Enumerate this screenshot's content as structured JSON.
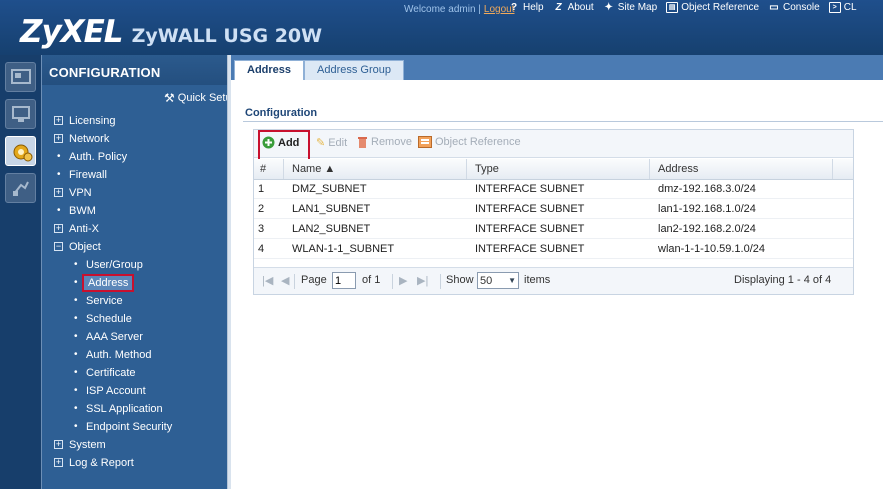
{
  "header": {
    "logo": "ZyXEL",
    "model": "ZyWALL USG 20W",
    "welcome": "Welcome admin |",
    "logout": "Logout",
    "links": [
      {
        "label": "Help",
        "icon": "help-icon"
      },
      {
        "label": "About",
        "icon": "about-icon"
      },
      {
        "label": "Site Map",
        "icon": "site-map-icon"
      },
      {
        "label": "Object Reference",
        "icon": "object-reference-icon"
      },
      {
        "label": "Console",
        "icon": "console-icon"
      },
      {
        "label": "CL",
        "icon": "cli-icon"
      }
    ]
  },
  "sidebar": {
    "title": "CONFIGURATION",
    "quick_setup": "Quick Setup",
    "items": [
      {
        "label": "Licensing",
        "marker": "+"
      },
      {
        "label": "Network",
        "marker": "+"
      },
      {
        "label": "Auth. Policy",
        "marker": "•"
      },
      {
        "label": "Firewall",
        "marker": "•"
      },
      {
        "label": "VPN",
        "marker": "+"
      },
      {
        "label": "BWM",
        "marker": "•"
      },
      {
        "label": "Anti-X",
        "marker": "+"
      },
      {
        "label": "Object",
        "marker": "−"
      },
      {
        "label": "User/Group",
        "marker": "•"
      },
      {
        "label": "Address",
        "marker": "•"
      },
      {
        "label": "Service",
        "marker": "•"
      },
      {
        "label": "Schedule",
        "marker": "•"
      },
      {
        "label": "AAA Server",
        "marker": "•"
      },
      {
        "label": "Auth. Method",
        "marker": "•"
      },
      {
        "label": "Certificate",
        "marker": "•"
      },
      {
        "label": "ISP Account",
        "marker": "•"
      },
      {
        "label": "SSL Application",
        "marker": "•"
      },
      {
        "label": "Endpoint Security",
        "marker": "•"
      },
      {
        "label": "System",
        "marker": "+"
      },
      {
        "label": "Log & Report",
        "marker": "+"
      }
    ]
  },
  "tabs": [
    {
      "label": "Address",
      "active": true
    },
    {
      "label": "Address Group",
      "active": false
    }
  ],
  "section_title": "Configuration",
  "toolbar": {
    "add": "Add",
    "edit": "Edit",
    "remove": "Remove",
    "object_reference": "Object Reference"
  },
  "table": {
    "columns": [
      "#",
      "Name ▲",
      "Type",
      "Address"
    ],
    "rows": [
      {
        "num": "1",
        "name": "DMZ_SUBNET",
        "type": "INTERFACE SUBNET",
        "address": "dmz-192.168.3.0/24"
      },
      {
        "num": "2",
        "name": "LAN1_SUBNET",
        "type": "INTERFACE SUBNET",
        "address": "lan1-192.168.1.0/24"
      },
      {
        "num": "3",
        "name": "LAN2_SUBNET",
        "type": "INTERFACE SUBNET",
        "address": "lan2-192.168.2.0/24"
      },
      {
        "num": "4",
        "name": "WLAN-1-1_SUBNET",
        "type": "INTERFACE SUBNET",
        "address": "wlan-1-1-10.59.1.0/24"
      }
    ]
  },
  "pager": {
    "page_label": "Page",
    "page_value": "1",
    "of_label": "of 1",
    "show_label": "Show",
    "show_value": "50",
    "items_label": "items",
    "displaying": "Displaying 1 - 4 of 4"
  },
  "colors": {
    "header_bg": "#1f4f8c",
    "sidebar_bg": "#2e5f94",
    "highlight": "#c8102e",
    "tab_bar": "#4b7bb3"
  }
}
